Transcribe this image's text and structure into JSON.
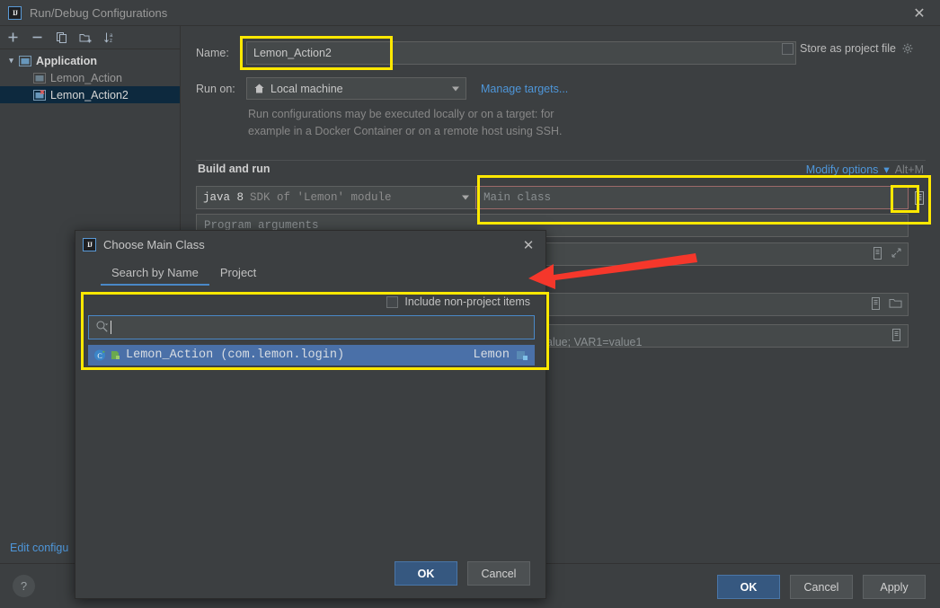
{
  "window": {
    "title": "Run/Debug Configurations",
    "logo": "intellij-idea-logo",
    "close_label": "✕"
  },
  "sidebar": {
    "toolbar": [
      {
        "name": "add-configuration-button",
        "label": "+"
      },
      {
        "name": "remove-configuration-button",
        "label": "−"
      },
      {
        "name": "copy-configuration-button",
        "label": "copy-icon"
      },
      {
        "name": "new-folder-button",
        "label": "new-folder-icon"
      },
      {
        "name": "sort-configurations-button",
        "label": "sort-alpha-icon"
      }
    ],
    "tree": [
      {
        "label": "Application",
        "type": "group",
        "expanded": true,
        "selected": false
      },
      {
        "label": "Lemon_Action",
        "type": "child",
        "selected": false
      },
      {
        "label": "Lemon_Action2",
        "type": "child",
        "selected": true
      }
    ],
    "edit_templates_link": "Edit configu"
  },
  "form": {
    "name_label": "Name:",
    "name_value": "Lemon_Action2",
    "store_as_project_file_label": "Store as project file",
    "store_as_project_file_checked": false,
    "run_on_label": "Run on:",
    "run_on_value": "Local machine",
    "manage_targets_link": "Manage targets...",
    "hint_line1": "Run configurations may be executed locally or on a target: for",
    "hint_line2": "example in a Docker Container or on a remote host using SSH.",
    "section_title": "Build and run",
    "modify_options_link": "Modify options",
    "modify_options_shortcut": "Alt+M",
    "sdk_keyword": "java 8",
    "sdk_description": "SDK of 'Lemon' module",
    "main_class_placeholder": "Main class",
    "main_class_value": "",
    "program_arguments_placeholder": "Program arguments",
    "env_vars_note": "alue; VAR1=value1"
  },
  "footer": {
    "help_label": "?",
    "ok_label": "OK",
    "cancel_label": "Cancel",
    "apply_label": "Apply"
  },
  "modal": {
    "title": "Choose Main Class",
    "logo": "intellij-idea-logo",
    "close_label": "✕",
    "tabs": [
      {
        "label": "Search by Name",
        "active": true
      },
      {
        "label": "Project",
        "active": false
      }
    ],
    "include_non_project_label": "Include non-project items",
    "include_non_project_checked": false,
    "search_value": "",
    "search_placeholder": "",
    "results": [
      {
        "name": "Lemon_Action (com.lemon.login)",
        "module": "Lemon",
        "selected": true,
        "class_icon": "java-class-icon",
        "marker_icon": "green-run-marker-icon",
        "module_icon": "module-icon"
      }
    ],
    "ok_label": "OK",
    "cancel_label": "Cancel"
  },
  "annotations": {
    "highlight_color": "#ffe800",
    "arrow_color": "#f5372b",
    "boxes": [
      {
        "name": "name-field-highlight"
      },
      {
        "name": "main-class-field-highlight"
      },
      {
        "name": "search-results-highlight"
      },
      {
        "name": "browse-button-highlight"
      }
    ],
    "arrows": [
      {
        "name": "pointer-to-browse-button"
      }
    ]
  },
  "colors": {
    "background": "#3c3f41",
    "field_background": "#45494a",
    "selection_blue": "#4a70a8",
    "tree_selection": "#0d293e",
    "link_blue": "#4e96d9",
    "accent_tab": "#4a88c7",
    "primary_button": "#365880",
    "error_border": "#9b6a6a"
  }
}
